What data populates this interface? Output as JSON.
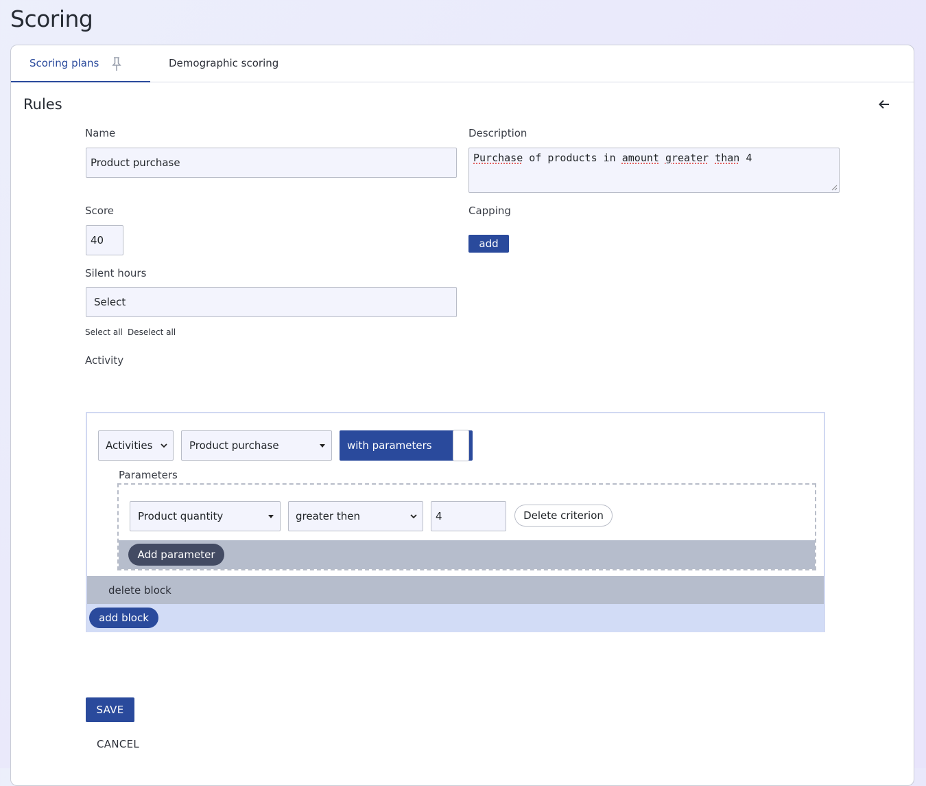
{
  "page": {
    "title": "Scoring"
  },
  "tabs": [
    {
      "label": "Scoring plans",
      "active": true
    },
    {
      "label": "Demographic scoring",
      "active": false
    }
  ],
  "rules": {
    "title": "Rules",
    "name": {
      "label": "Name",
      "value": "Product purchase"
    },
    "description": {
      "label": "Description",
      "words": [
        "Purchase",
        "of",
        "products",
        "in",
        "amount",
        "greater",
        "than",
        "4"
      ]
    },
    "score": {
      "label": "Score",
      "value": "40"
    },
    "capping": {
      "label": "Capping",
      "add_label": "add"
    },
    "silent_hours": {
      "label": "Silent hours",
      "value": "Select",
      "select_all": "Select all",
      "deselect_all": "Deselect all"
    },
    "activity": {
      "label": "Activity",
      "type_select": "Activities",
      "activity_select": "Product purchase",
      "toggle_label": "with parameters",
      "parameters_label": "Parameters",
      "criterion": {
        "field": "Product quantity",
        "operator": "greater then",
        "value": "4",
        "delete_label": "Delete criterion"
      },
      "add_parameter_label": "Add parameter",
      "delete_block_label": "delete block",
      "add_block_label": "add block"
    },
    "save_label": "SAVE",
    "cancel_label": "CANCEL"
  },
  "colors": {
    "primary": "#2a4a9c",
    "dark_pill": "#434b63",
    "bar_gray": "#b6bdcc",
    "bar_blue": "#d2dcf6"
  },
  "icons": {
    "pin": "pin-icon",
    "back": "arrow-left-icon"
  }
}
